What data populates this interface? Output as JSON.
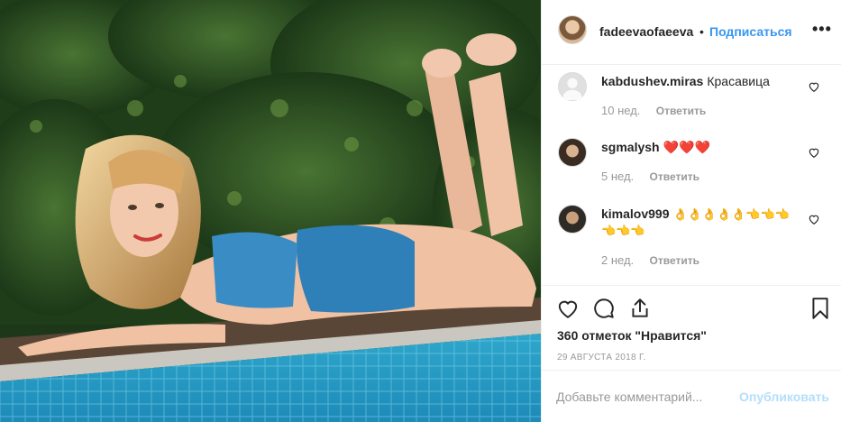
{
  "post": {
    "image_description_icon": "photo-icon",
    "header": {
      "username": "fadeevaofaeeva",
      "separator": "•",
      "follow_label": "Подписаться",
      "more_icon": "more-icon",
      "more_label": "•••"
    },
    "comments": [
      {
        "username": "kabdushev.miras",
        "text": "Красавица",
        "time": "10 нед.",
        "reply_label": "Ответить"
      },
      {
        "username": "sgmalysh",
        "text": "❤️❤️❤️",
        "time": "5 нед.",
        "reply_label": "Ответить"
      },
      {
        "username": "kimalov999",
        "text": "👌👌👌👌👌👈👈👈👈👈👈",
        "time": "2 нед.",
        "reply_label": "Ответить"
      }
    ],
    "likes_text": "360 отметок \"Нравится\"",
    "date_text": "29 АВГУСТА 2018 Г.",
    "add_comment": {
      "placeholder": "Добавьте комментарий...",
      "post_label": "Опубликовать"
    }
  },
  "colors": {
    "link": "#3897f0",
    "muted": "#999999",
    "post_disabled": "#b2dffc",
    "border": "#efefef"
  }
}
